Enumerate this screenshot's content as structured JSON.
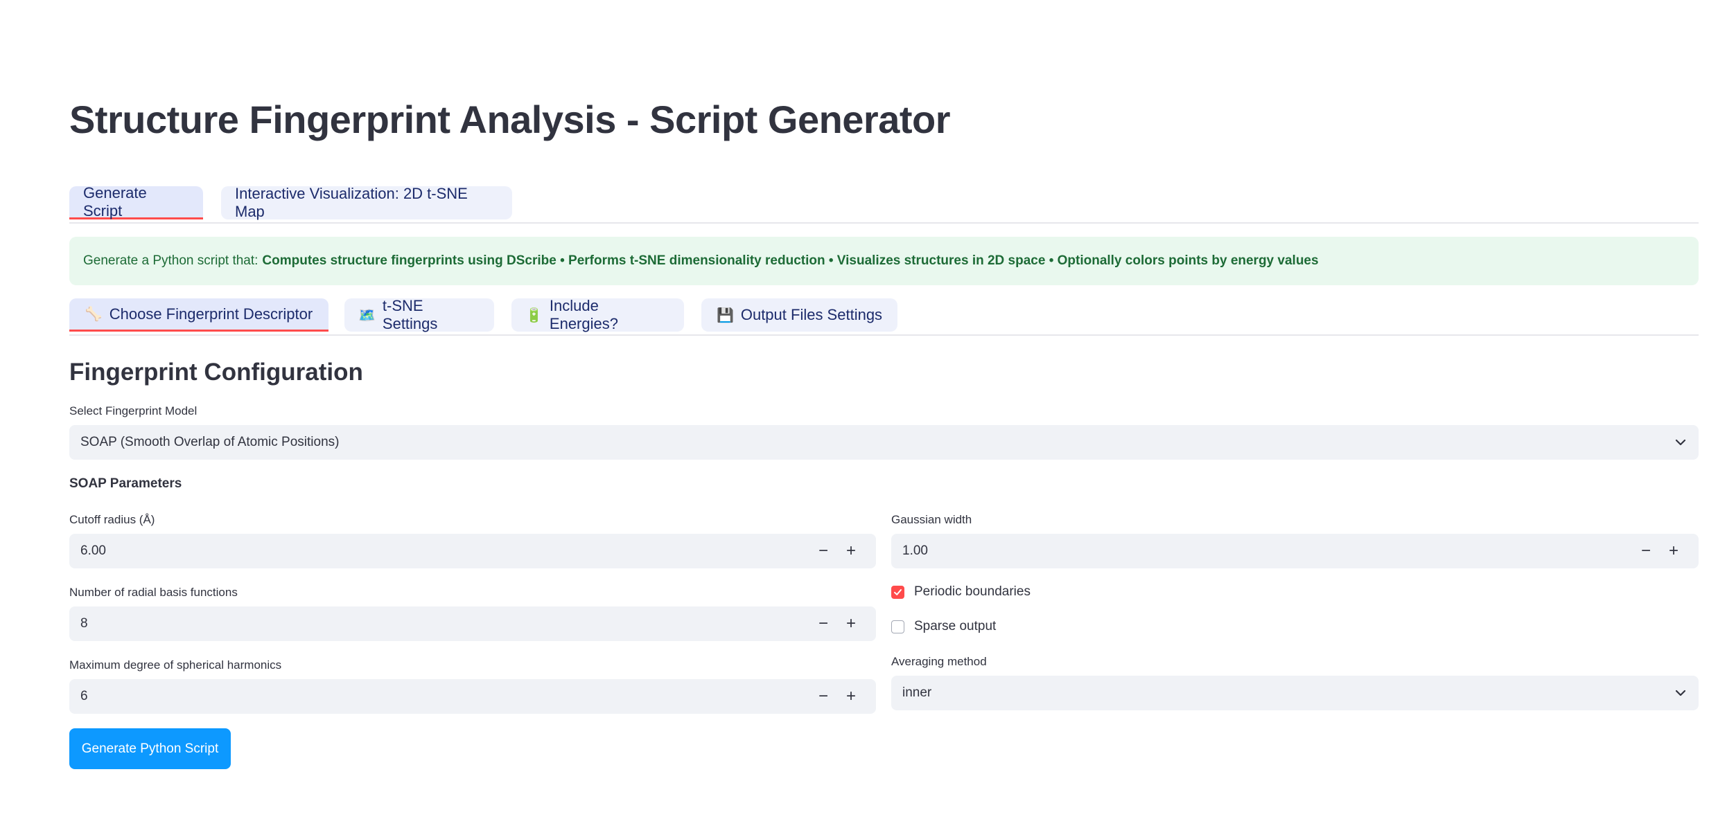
{
  "page": {
    "title": "Structure Fingerprint Analysis - Script Generator"
  },
  "top_tabs": [
    {
      "label": "Generate Script",
      "active": true
    },
    {
      "label": "Interactive Visualization: 2D t-SNE Map",
      "active": false
    }
  ],
  "info": {
    "prefix": "Generate a Python script that:",
    "bold": "Computes structure fingerprints using DScribe • Performs t-SNE dimensionality reduction • Visualizes structures in 2D space • Optionally colors points by energy values"
  },
  "sub_tabs": [
    {
      "icon": "🦴",
      "icon_name": "bone-icon",
      "label": "Choose Fingerprint Descriptor",
      "active": true
    },
    {
      "icon": "🗺️",
      "icon_name": "map-icon",
      "label": "t-SNE Settings",
      "active": false
    },
    {
      "icon": "🔋",
      "icon_name": "battery-icon",
      "label": "Include Energies?",
      "active": false
    },
    {
      "icon": "💾",
      "icon_name": "floppy-disk-icon",
      "label": "Output Files Settings",
      "active": false
    }
  ],
  "section": {
    "title": "Fingerprint Configuration"
  },
  "model_select": {
    "label": "Select Fingerprint Model",
    "value": "SOAP (Smooth Overlap of Atomic Positions)"
  },
  "soap": {
    "heading": "SOAP Parameters",
    "cutoff": {
      "label": "Cutoff radius (Å)",
      "value": "6.00"
    },
    "nmax": {
      "label": "Number of radial basis functions",
      "value": "8"
    },
    "lmax": {
      "label": "Maximum degree of spherical harmonics",
      "value": "6"
    },
    "sigma": {
      "label": "Gaussian width",
      "value": "1.00"
    },
    "periodic": {
      "label": "Periodic boundaries",
      "checked": true
    },
    "sparse": {
      "label": "Sparse output",
      "checked": false
    },
    "averaging": {
      "label": "Averaging method",
      "value": "inner"
    }
  },
  "stepper": {
    "minus": "−",
    "plus": "+"
  },
  "generate_button": {
    "label": "Generate Python Script"
  },
  "colors": {
    "accent": "#ff4b4b",
    "primary_button": "#0d99ff",
    "info_bg": "#e9f8ee",
    "info_text": "#1d6b36"
  }
}
